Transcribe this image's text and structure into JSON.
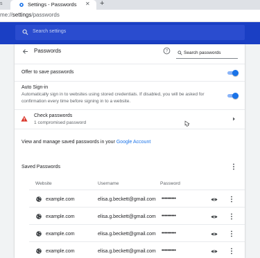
{
  "browser": {
    "tab_title": "Settings - Passwords",
    "tab_close": "✕",
    "left_tab_stub": "s",
    "new_tab": "+",
    "url_prefix": "me://",
    "url_path": "settings",
    "url_suffix": "/passwords"
  },
  "header": {
    "search_placeholder": "Search settings",
    "accent_color": "#1a3fc4"
  },
  "passwords_page": {
    "title": "Passwords",
    "search_placeholder": "Search passwords",
    "offer_to_save": {
      "label": "Offer to save passwords",
      "enabled": true
    },
    "auto_signin": {
      "label": "Auto Sign-in",
      "description_line1": "Automatically sign in to websites using stored credentials. If disabled, you will be asked for",
      "description_line2": "confirmation every time before signing in to a website.",
      "enabled": true
    },
    "check_passwords": {
      "label": "Check passwords",
      "sub": "1 compromised password"
    },
    "manage_text": "View and manage saved passwords in your",
    "manage_link": "Google Account",
    "saved_title": "Saved Passwords",
    "columns": [
      "Website",
      "Username",
      "Password"
    ],
    "rows": [
      {
        "site": "example.com",
        "username": "elisa.g.beckett@gmail.com",
        "password": "••••••••••"
      },
      {
        "site": "example.com",
        "username": "elisa.g.beckett@gmail.com",
        "password": "••••••••••"
      },
      {
        "site": "example.com",
        "username": "elisa.g.beckett@gmail.com",
        "password": "••••••••••"
      },
      {
        "site": "example.com",
        "username": "elisa.g.beckett@gmail.com",
        "password": "••••••••••"
      }
    ]
  }
}
